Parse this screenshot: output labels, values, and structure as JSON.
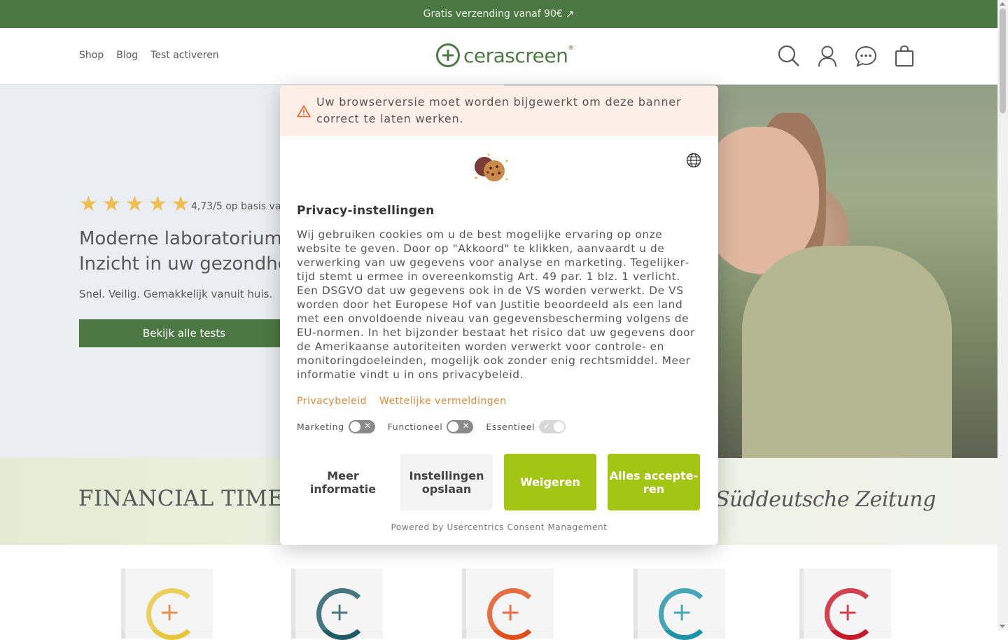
{
  "topbar": {
    "text": "Gratis verzending vanaf 90€",
    "arrow": "↗"
  },
  "nav": {
    "items": [
      "Shop",
      "Blog",
      "Test activeren"
    ]
  },
  "logo": {
    "text": "cerascreen",
    "reg": "®"
  },
  "header_icons": [
    "search-icon",
    "account-icon",
    "chat-icon",
    "cart-icon"
  ],
  "hero": {
    "stars": 5,
    "rating": "4,73/5 op basis va",
    "headline_1": "Moderne laboratoriumar",
    "headline_2": "Inzicht in uw gezondheic",
    "sub": "Snel. Veilig. Gemakkelijk vanuit huis.",
    "cta": "Bekijk alle tests"
  },
  "press": {
    "left": "FINANCIAL TIMES",
    "right": "Süddeutsche Zeitung"
  },
  "modal": {
    "warning": "Uw browserversie moet worden bijgewerkt om deze banner cor­rect te laten werken.",
    "title": "Privacy-instellingen",
    "text": "Wij gebruiken cookies om u de best mogelijke ervaring op onze website te geven. Door op \"Akkoord\" te klikken, aanvaardt u de verwerking van uw gegevens voor analyse en marketing. Tegelijker­tijd stemt u ermee in overeenkomstig Art. 49 par. 1 blz. 1 verlicht. Een DSGVO dat uw gegevens ook in de VS worden verwerkt. De VS worden door het Europese Hof van Justitie beoordeeld als een land met een onvoldoende niveau van gegevensbescherming volgens de EU-normen. In het bijzonder bestaat het risico dat uw gegevens door de Amerikaanse autoriteiten worden verwerkt voor controle- en monitoringdoeleinden, mogelijk ook zonder enig rechtsmiddel. Meer informatie vindt u in ons privacybeleid.",
    "link_privacy": "Privacybeleid",
    "link_legal": "Wettelijke vermeldingen",
    "toggle_marketing": "Marketing",
    "toggle_functional": "Functioneel",
    "toggle_essential": "Essentieel",
    "btn_more": "Meer informatie",
    "btn_save": "Instellin­gen opslaan",
    "btn_reject": "Weigeren",
    "btn_accept": "Alles accepte­ren",
    "powered": "Powered by Usercentrics Consent Management"
  },
  "colors": {
    "brand_green": "#245b1a",
    "accent_lime": "#a3c614",
    "link_orange": "#e08a3a",
    "star_yellow": "#e8b12a"
  }
}
